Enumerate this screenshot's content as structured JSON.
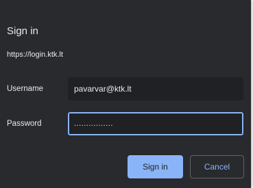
{
  "dialog": {
    "title": "Sign in",
    "origin": "https://login.ktk.lt",
    "username_label": "Username",
    "username_value": "pavarvar@ktk.lt",
    "password_label": "Password",
    "password_value": "................",
    "signin_label": "Sign in",
    "cancel_label": "Cancel"
  },
  "colors": {
    "background": "#292a2d",
    "field_background": "#202124",
    "accent": "#8ab4f8",
    "text": "#e8eaed"
  }
}
